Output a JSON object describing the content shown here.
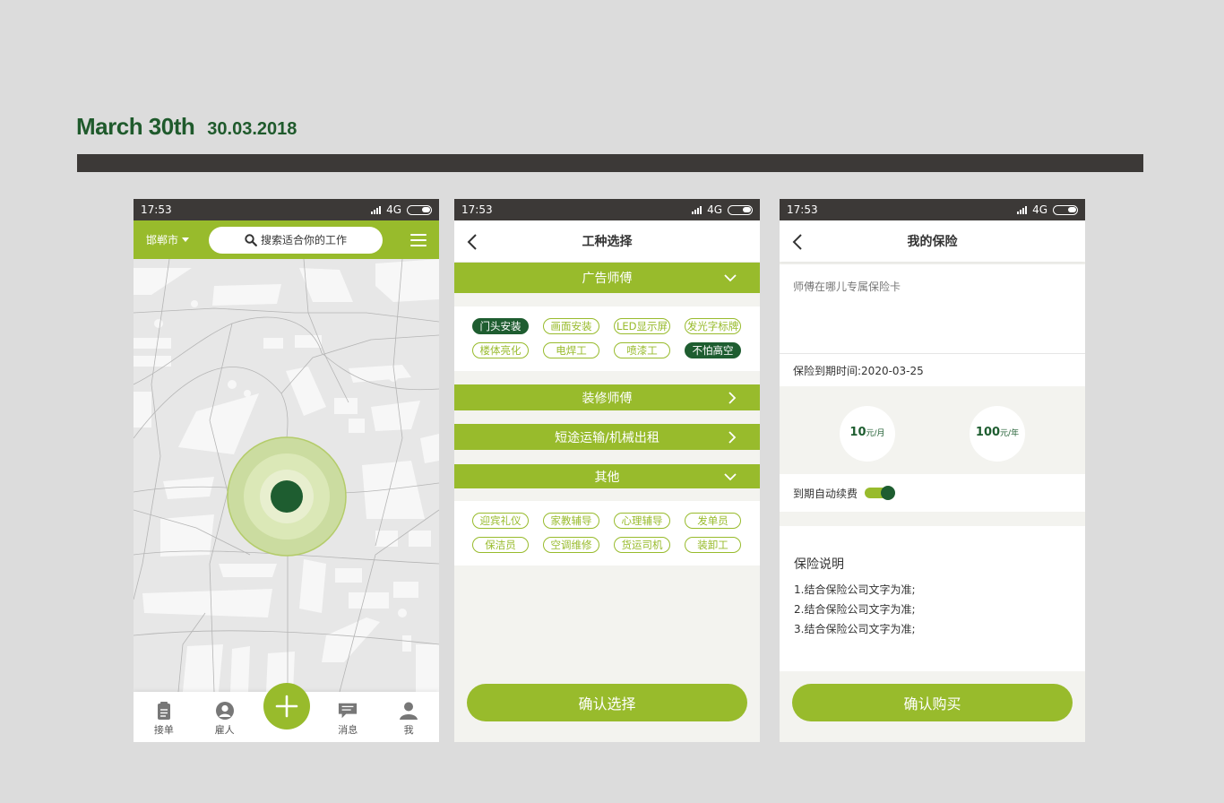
{
  "heading": {
    "title": "March 30th",
    "date": "30.03.2018"
  },
  "status": {
    "time": "17:53",
    "network": "4G"
  },
  "phone1": {
    "city": "邯郸市",
    "search_placeholder": "搜索适合你的工作",
    "tabs": [
      {
        "label": "接单",
        "icon": "clipboard-icon"
      },
      {
        "label": "雇人",
        "icon": "person-circle-icon"
      },
      {
        "label": "消息",
        "icon": "message-icon"
      },
      {
        "label": "我",
        "icon": "user-icon"
      }
    ],
    "fab_icon": "plus-icon"
  },
  "phone2": {
    "title": "工种选择",
    "categories": [
      {
        "label": "广告师傅",
        "state": "expanded"
      },
      {
        "label": "装修师傅",
        "state": "collapsed"
      },
      {
        "label": "短途运输/机械出租",
        "state": "collapsed"
      },
      {
        "label": "其他",
        "state": "expanded"
      }
    ],
    "ad_tags": [
      "门头安装",
      "画面安装",
      "LED显示屏",
      "发光字标牌",
      "楼体亮化",
      "电焊工",
      "喷漆工",
      "不怕高空"
    ],
    "other_tags": [
      "迎宾礼仪",
      "家教辅导",
      "心理辅导",
      "发单员",
      "保洁员",
      "空调维修",
      "货运司机",
      "装卸工"
    ],
    "confirm": "确认选择"
  },
  "phone3": {
    "title": "我的保险",
    "card_title": "师傅在哪儿专属保险卡",
    "expire": "保险到期时间:2020-03-25",
    "plans": [
      {
        "amount": "10",
        "unit": "元/月"
      },
      {
        "amount": "100",
        "unit": "元/年"
      }
    ],
    "auto_renew": "到期自动续费",
    "notes_title": "保险说明",
    "notes": [
      "1.结合保险公司文字为准;",
      "2.结合保险公司文字为准;",
      "3.结合保险公司文字为准;"
    ],
    "buy": "确认购买"
  },
  "colors": {
    "brand_green": "#98bb2c",
    "dark_green": "#1e5d30",
    "bar_dark": "#3c3937"
  }
}
